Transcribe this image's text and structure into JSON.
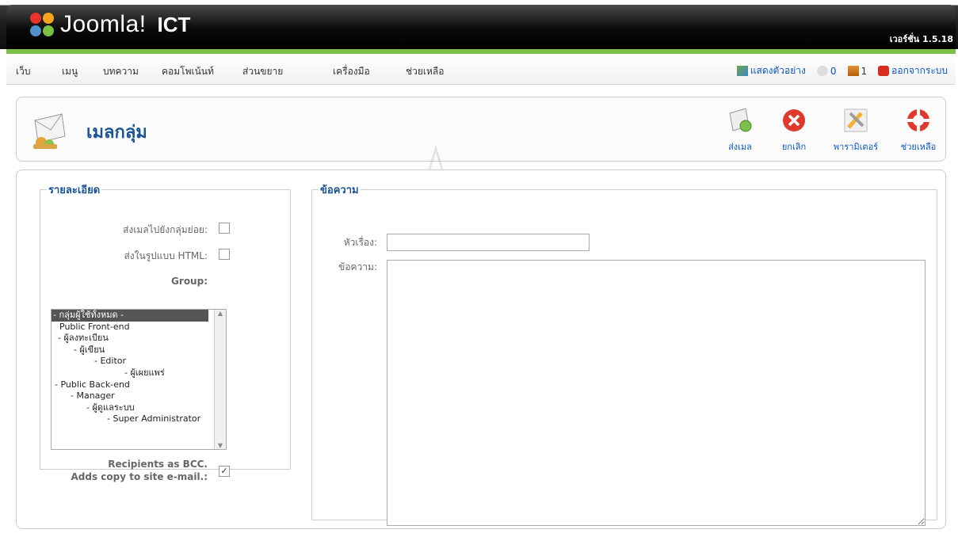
{
  "header": {
    "brand": "Joomla!",
    "site_name": "ICT",
    "version": "เวอร์ชั่น 1.5.18"
  },
  "menu": {
    "items": [
      "เว็บ",
      "เมนู",
      "บทความ",
      "คอมโพเน้นท์",
      "ส่วนขยาย",
      "เครื่องมือ",
      "ช่วยเหลือ"
    ]
  },
  "status": {
    "preview": "แสดงตัวอย่าง",
    "messages_count": "0",
    "users_count": "1",
    "logout": "ออกจากระบบ"
  },
  "toolbar": {
    "title": "เมลกลุ่ม",
    "buttons": {
      "send": "ส่งเมล",
      "cancel": "ยกเลิก",
      "parameters": "พารามิเตอร์",
      "help": "ช่วยเหลือ"
    }
  },
  "details": {
    "legend": "รายละเอียด",
    "send_to_subgroups": "ส่งเมลไปยังกลุ่มย่อย:",
    "send_html": "ส่งในรูปแบบ HTML:",
    "group_label": "Group:",
    "group_options": [
      "- กลุ่มผู้ใช้ทั้งหมด -",
      "Public Front-end",
      "- ผู้ลงทะเบียน",
      "- ผู้เขียน",
      "- Editor",
      "- ผู้เผยแพร่",
      "- Public Back-end",
      "- Manager",
      "- ผู้ดูแลระบบ",
      "- Super Administrator"
    ],
    "bcc_line1": "Recipients as BCC.",
    "bcc_line2": "Adds copy to site e-mail.:",
    "bcc_checked": true
  },
  "message": {
    "legend": "ข้อความ",
    "subject_label": "หัวเรื่อง:",
    "subject_value": "",
    "message_label": "ข้อความ:",
    "message_value": ""
  },
  "colors": {
    "accent_green": "#7cc04b",
    "title_blue": "#1a5494",
    "link_blue": "#0b55c4"
  }
}
